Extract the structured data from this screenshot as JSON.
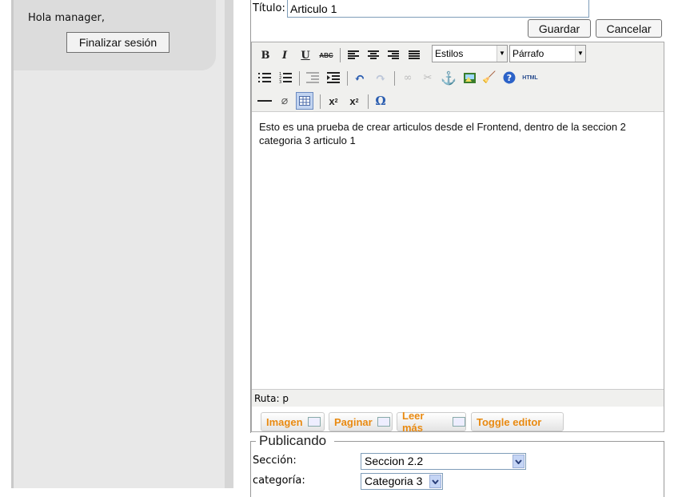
{
  "sidebar": {
    "greeting": "Hola manager,",
    "logout_label": "Finalizar sesión"
  },
  "form": {
    "title_label": "Título:",
    "title_value": "Articulo 1",
    "save_label": "Guardar",
    "cancel_label": "Cancelar"
  },
  "editor": {
    "styles_select": "Estilos",
    "format_select": "Párrafo",
    "content": "Esto es una prueba de crear articulos desde el Frontend, dentro de la seccion 2 categoria 3 articulo 1",
    "path_label": "Ruta: p",
    "extra_buttons": [
      "Imagen",
      "Paginar",
      "Leer más",
      "Toggle editor"
    ]
  },
  "publishing": {
    "legend": "Publicando",
    "section_label": "Sección:",
    "section_value": "Seccion 2.2",
    "category_label": "categoría:",
    "category_value": "Categoria 3"
  }
}
